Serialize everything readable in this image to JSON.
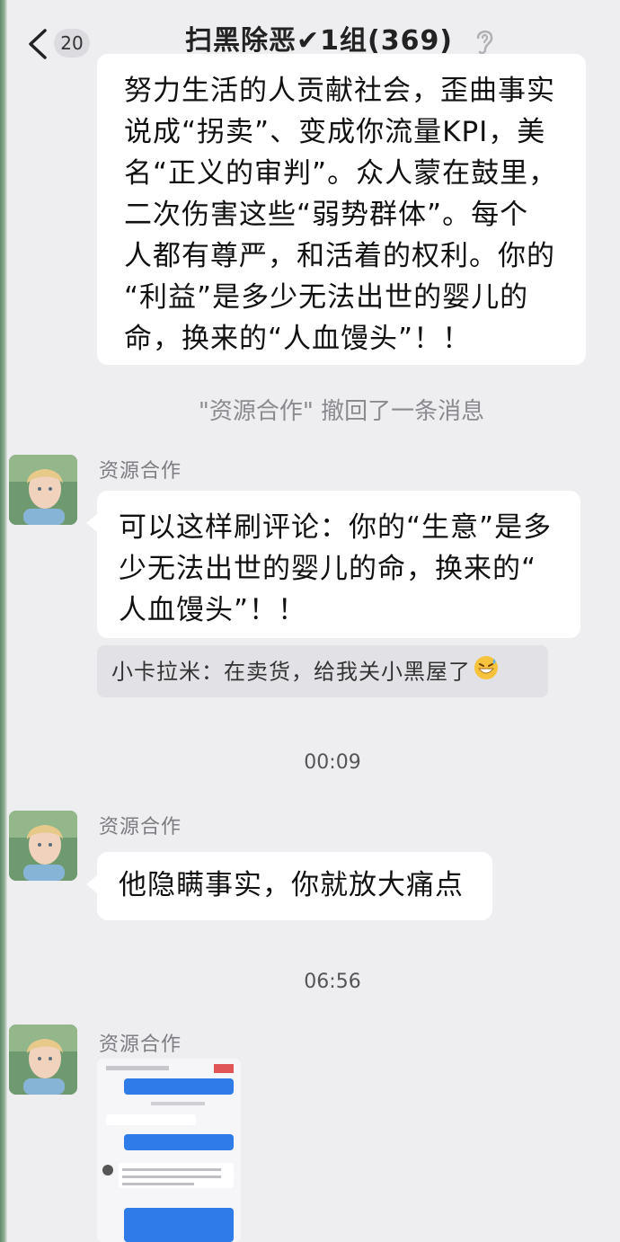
{
  "header": {
    "unread_count": "20",
    "title": "扫黑除恶✔1组(369)"
  },
  "messages": {
    "top_bubble_lines": [
      "努力生活的人贡献社会，歪曲事实",
      "说成“拐卖”、变成你流量KPI，美",
      "名“正义的审判”。众人蒙在鼓里，",
      "二次伤害这些“弱势群体”。每个",
      "人都有尊严，和活着的权利。你的",
      "“利益”是多少无法出世的婴儿的",
      "命，换来的“人血馒头”！！"
    ],
    "recall_note": "\"资源合作\" 撤回了一条消息",
    "msg2_sender": "资源合作",
    "msg2_lines": [
      "可以这样刷评论：你的“生意”是多",
      "少无法出世的婴儿的命，换来的“",
      "人血馒头”！！"
    ],
    "quote_text": "小卡拉米：在卖货，给我关小黑屋了",
    "time_1": "00:09",
    "msg3_sender": "资源合作",
    "msg3_text": "他隐瞒事实，你就放大痛点",
    "time_2": "06:56",
    "msg4_sender": "资源合作"
  },
  "colors": {
    "background": "#eeeef1",
    "bubble": "#ffffff",
    "quote_background": "#e2e2e6",
    "muted_text": "#8b8b8f",
    "image_blue_bar": "#2f7be8"
  },
  "icons": [
    "back-chevron-icon",
    "ear-icon",
    "grin-sweat-emoji-icon"
  ]
}
